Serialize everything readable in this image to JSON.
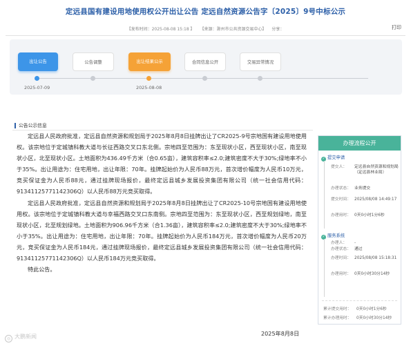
{
  "header": {
    "title": "定远县国有建设用地使用权公开出让公告 定远自然资源公告字〔2025〕9号中标公示",
    "publish_time": "【发布时间：2025-08-08 15:18 】",
    "source": "【来源：滁州市公共资源交易中心】",
    "share": "分享：",
    "print": "打印"
  },
  "steps": [
    {
      "label": "出让公告",
      "state": "active-blue"
    },
    {
      "label": "公告调整",
      "state": "inactive"
    },
    {
      "label": "出让结果公示",
      "state": "active-orange"
    },
    {
      "label": "合同信息公开",
      "state": "inactive"
    },
    {
      "label": "交易异常情况",
      "state": "inactive"
    }
  ],
  "timeline_dates": [
    "2025-07-09",
    "2025-08-08"
  ],
  "section": {
    "title": "公告公示信息"
  },
  "paragraphs": [
    "定远县人民政府批准，定远县自然资源和规划局于2025年8月8日挂牌出让了CR2025-9号宗地国有建设用地使用权。该宗地位于定城镇科教大道与长征西路交叉口东北侧。宗地四至范围为：东至现状小区，西至现状小区，南至现状小区，北至现状小区。土地面积为436.49千方米（合0.65亩），建筑容积率≤2.0;建筑密度不大于30%;绿地率不小于35%。出让用途为：住宅用地，出让年限：70年。挂牌起始价为人民币88万元，首次增价幅度为人民币10万元，竞买保证金为人民币88元，通过挂牌现场报价，最终定远县城乡发展投资集团有限公司（统一社会信用代码：91341125771142306Q）以人民币88万元竞买取得。",
    "定远县人民政府批准，定远县自然资源和规划局于2025年8月8日挂牌出让了CR2025-10号宗地国有建设用地使用权。该宗地位于定城镇科教大道与幸福西路交叉口东南侧。宗地四至范围为：东至现状小区，西至规划绿地，南至现状小区，北至规划绿地。土地面积为906.96千方米（合1.36亩），建筑容积率≤2.0;建筑密度不大于30%;绿地率不小于35%。出让用途为：住宅用地，出让年限：70年。挂牌起始价为人民币184万元，首次增价幅度为人民币20万元，竞买保证金为人民币184元，通过挂牌现场报价，最终定远县城乡发展投资集团有限公司（统一社会信用代码：91341125771142306Q）以人民币184万元竞买取得。",
    "特此公告。"
  ],
  "sign_date": "2025年8月8日",
  "sidebar": {
    "title": "办理流程公开",
    "stage1": {
      "title": "提交申请",
      "rows": [
        {
          "k": "提交人：",
          "v": "定远县自然资源和规划局（定远县林业局）"
        },
        {
          "k": "办理状态：",
          "v": "业务提交"
        },
        {
          "k": "提交时间：",
          "v": "2025/08/08 14:49:17"
        },
        {
          "k": "办理用时：",
          "v": "0天0小时1分6秒"
        }
      ]
    },
    "stage2": {
      "title": "服务系统",
      "rows": [
        {
          "k": "办理人：",
          "v": "-"
        },
        {
          "k": "办理状态：",
          "v": "通过"
        },
        {
          "k": "办理时间：",
          "v": "2025/08/08 15:18:31"
        },
        {
          "k": "办理用时：",
          "v": "0天0小时30分14秒"
        }
      ]
    },
    "summary": [
      {
        "k": "累计提交用时：",
        "v": "0天0小时1分6秒"
      },
      {
        "k": "累计办理用时：",
        "v": "0天0小时30分14秒"
      }
    ]
  },
  "watermark": "大鹏新闻"
}
